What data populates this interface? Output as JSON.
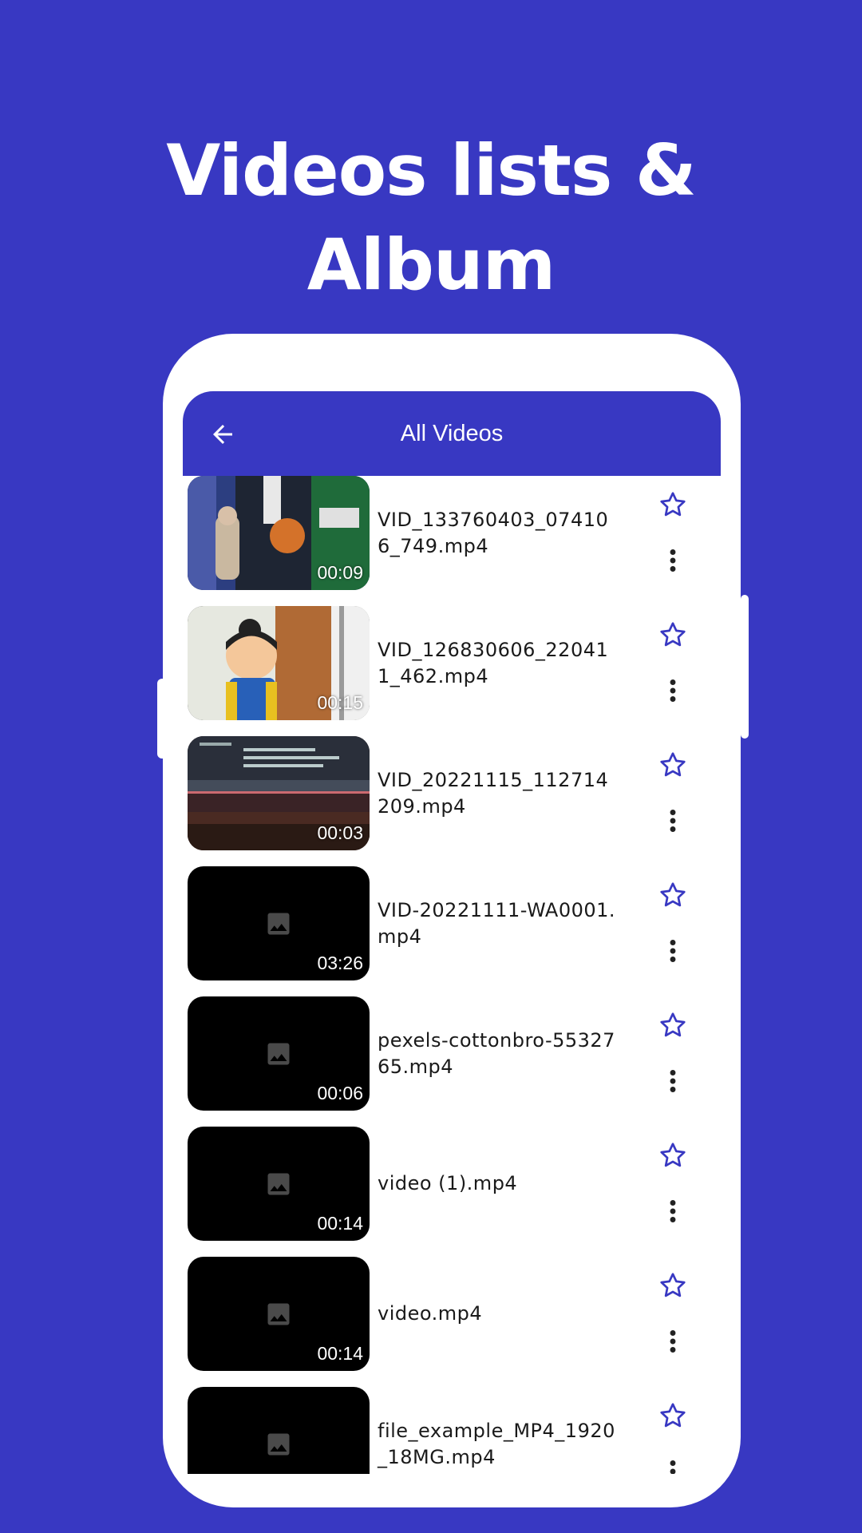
{
  "promo": {
    "headline_line1": "Videos lists &",
    "headline_line2": "Album"
  },
  "colors": {
    "background": "#3838c2",
    "appbar": "#3838c2",
    "star": "#3838c2"
  },
  "appbar": {
    "back_icon": "arrow-left-icon",
    "title": "All Videos"
  },
  "videos": [
    {
      "title": "VID_133760403_074106_749.mp4",
      "duration": "00:09",
      "thumbnail": "basketball-scene"
    },
    {
      "title": "VID_126830606_220411_462.mp4",
      "duration": "00:15",
      "thumbnail": "cartoon-girl"
    },
    {
      "title": "VID_20221115_112714209.mp4",
      "duration": "00:03",
      "thumbnail": "screen-recording"
    },
    {
      "title": "VID-20221111-WA0001.mp4",
      "duration": "03:26",
      "thumbnail": "image-placeholder-icon"
    },
    {
      "title": "pexels-cottonbro-5532765.mp4",
      "duration": "00:06",
      "thumbnail": "image-placeholder-icon"
    },
    {
      "title": "video (1).mp4",
      "duration": "00:14",
      "thumbnail": "image-placeholder-icon"
    },
    {
      "title": "video.mp4",
      "duration": "00:14",
      "thumbnail": "image-placeholder-icon"
    },
    {
      "title": "file_example_MP4_1920_18MG.mp4",
      "duration": "",
      "thumbnail": "image-placeholder-icon"
    }
  ]
}
